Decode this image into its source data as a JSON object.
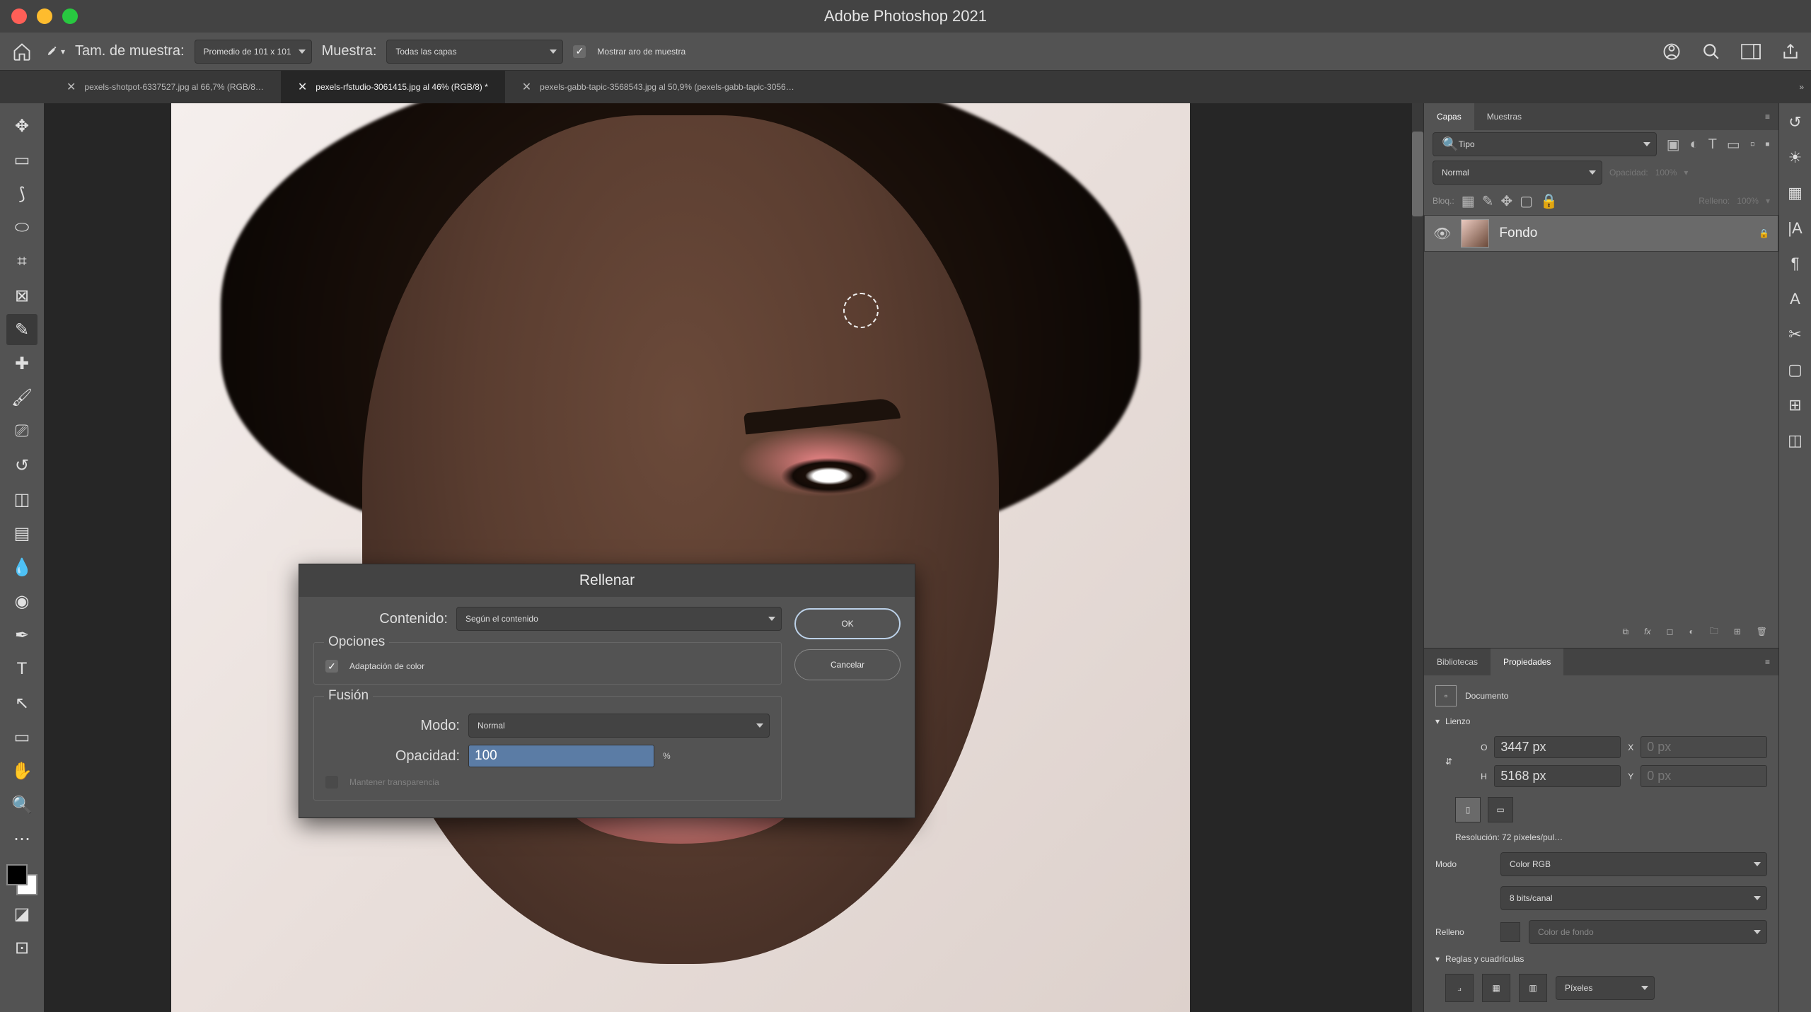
{
  "app_title": "Adobe Photoshop 2021",
  "options_bar": {
    "sample_size_label": "Tam. de muestra:",
    "sample_size_value": "Promedio de 101 x 101",
    "sample_label": "Muestra:",
    "sample_value": "Todas las capas",
    "show_ring_label": "Mostrar aro de muestra"
  },
  "doc_tabs": [
    {
      "label": "pexels-shotpot-6337527.jpg al 66,7% (RGB/8…",
      "active": false
    },
    {
      "label": "pexels-rfstudio-3061415.jpg al 46% (RGB/8) *",
      "active": true
    },
    {
      "label": "pexels-gabb-tapic-3568543.jpg al 50,9% (pexels-gabb-tapic-3056…",
      "active": false
    }
  ],
  "tools": [
    {
      "name": "move-tool",
      "glyph": "✥"
    },
    {
      "name": "marquee-tool",
      "glyph": "▭"
    },
    {
      "name": "lasso-tool",
      "glyph": "⟆"
    },
    {
      "name": "quick-select-tool",
      "glyph": "⬭"
    },
    {
      "name": "crop-tool",
      "glyph": "⌗"
    },
    {
      "name": "frame-tool",
      "glyph": "⊠"
    },
    {
      "name": "eyedropper-tool",
      "glyph": "✎"
    },
    {
      "name": "heal-tool",
      "glyph": "✚"
    },
    {
      "name": "brush-tool",
      "glyph": "🖌"
    },
    {
      "name": "stamp-tool",
      "glyph": "⎚"
    },
    {
      "name": "history-brush-tool",
      "glyph": "↺"
    },
    {
      "name": "eraser-tool",
      "glyph": "◫"
    },
    {
      "name": "gradient-tool",
      "glyph": "▤"
    },
    {
      "name": "blur-tool",
      "glyph": "💧"
    },
    {
      "name": "dodge-tool",
      "glyph": "◉"
    },
    {
      "name": "pen-tool",
      "glyph": "✒"
    },
    {
      "name": "type-tool",
      "glyph": "T"
    },
    {
      "name": "path-select-tool",
      "glyph": "↖"
    },
    {
      "name": "shape-tool",
      "glyph": "▭"
    },
    {
      "name": "hand-tool",
      "glyph": "✋"
    },
    {
      "name": "zoom-tool",
      "glyph": "🔍"
    },
    {
      "name": "more-tool",
      "glyph": "⋯"
    }
  ],
  "swatch_mode_glyphs": [
    "◪",
    "⊡"
  ],
  "layers_panel": {
    "tabs": {
      "capas": "Capas",
      "muestras": "Muestras"
    },
    "filter_kind_value": "Tipo",
    "blend_mode_value": "Normal",
    "opacity_label": "Opacidad:",
    "opacity_value": "100%",
    "lock_label": "Bloq.:",
    "fill_label": "Relleno:",
    "fill_value": "100%",
    "layer_name": "Fondo"
  },
  "props_panel": {
    "tabs": {
      "bibliotecas": "Bibliotecas",
      "propiedades": "Propiedades"
    },
    "doc_label": "Documento",
    "canvas_section": "Lienzo",
    "w_label": "O",
    "w_value": "3447 px",
    "h_label": "H",
    "h_value": "5168 px",
    "x_label": "X",
    "x_value": "0 px",
    "y_label": "Y",
    "y_value": "0 px",
    "res_label": "Resolución: 72 píxeles/pul…",
    "mode_label": "Modo",
    "mode_value": "Color RGB",
    "bits_value": "8 bits/canal",
    "fill_label": "Relleno",
    "fill_value": "Color de fondo",
    "rulers_section": "Reglas y cuadrículas",
    "rulers_unit": "Píxeles"
  },
  "dialog": {
    "title": "Rellenar",
    "content_label": "Contenido:",
    "content_value": "Según el contenido",
    "options_legend": "Opciones",
    "color_adapt_label": "Adaptación de color",
    "fusion_legend": "Fusión",
    "mode_label": "Modo:",
    "mode_value": "Normal",
    "opacity_label": "Opacidad:",
    "opacity_value": "100",
    "opacity_unit": "%",
    "preserve_label": "Mantener transparencia",
    "ok": "OK",
    "cancel": "Cancelar"
  },
  "right_dock": [
    {
      "name": "history-icon",
      "glyph": "↺"
    },
    {
      "name": "adjust-icon",
      "glyph": "☀"
    },
    {
      "name": "swatches-icon",
      "glyph": "▦"
    },
    {
      "name": "glyphs-icon",
      "glyph": "|A"
    },
    {
      "name": "paragraph-icon",
      "glyph": "¶"
    },
    {
      "name": "character-icon",
      "glyph": "A"
    },
    {
      "name": "actions-icon",
      "glyph": "✂"
    },
    {
      "name": "navigator-icon",
      "glyph": "▢"
    },
    {
      "name": "info-icon",
      "glyph": "⊞"
    },
    {
      "name": "styles-icon",
      "glyph": "◫"
    }
  ],
  "header_icons": {
    "cloud": "cloud-icon",
    "search": "search-icon",
    "workspace": "workspace-icon",
    "share": "share-icon"
  }
}
